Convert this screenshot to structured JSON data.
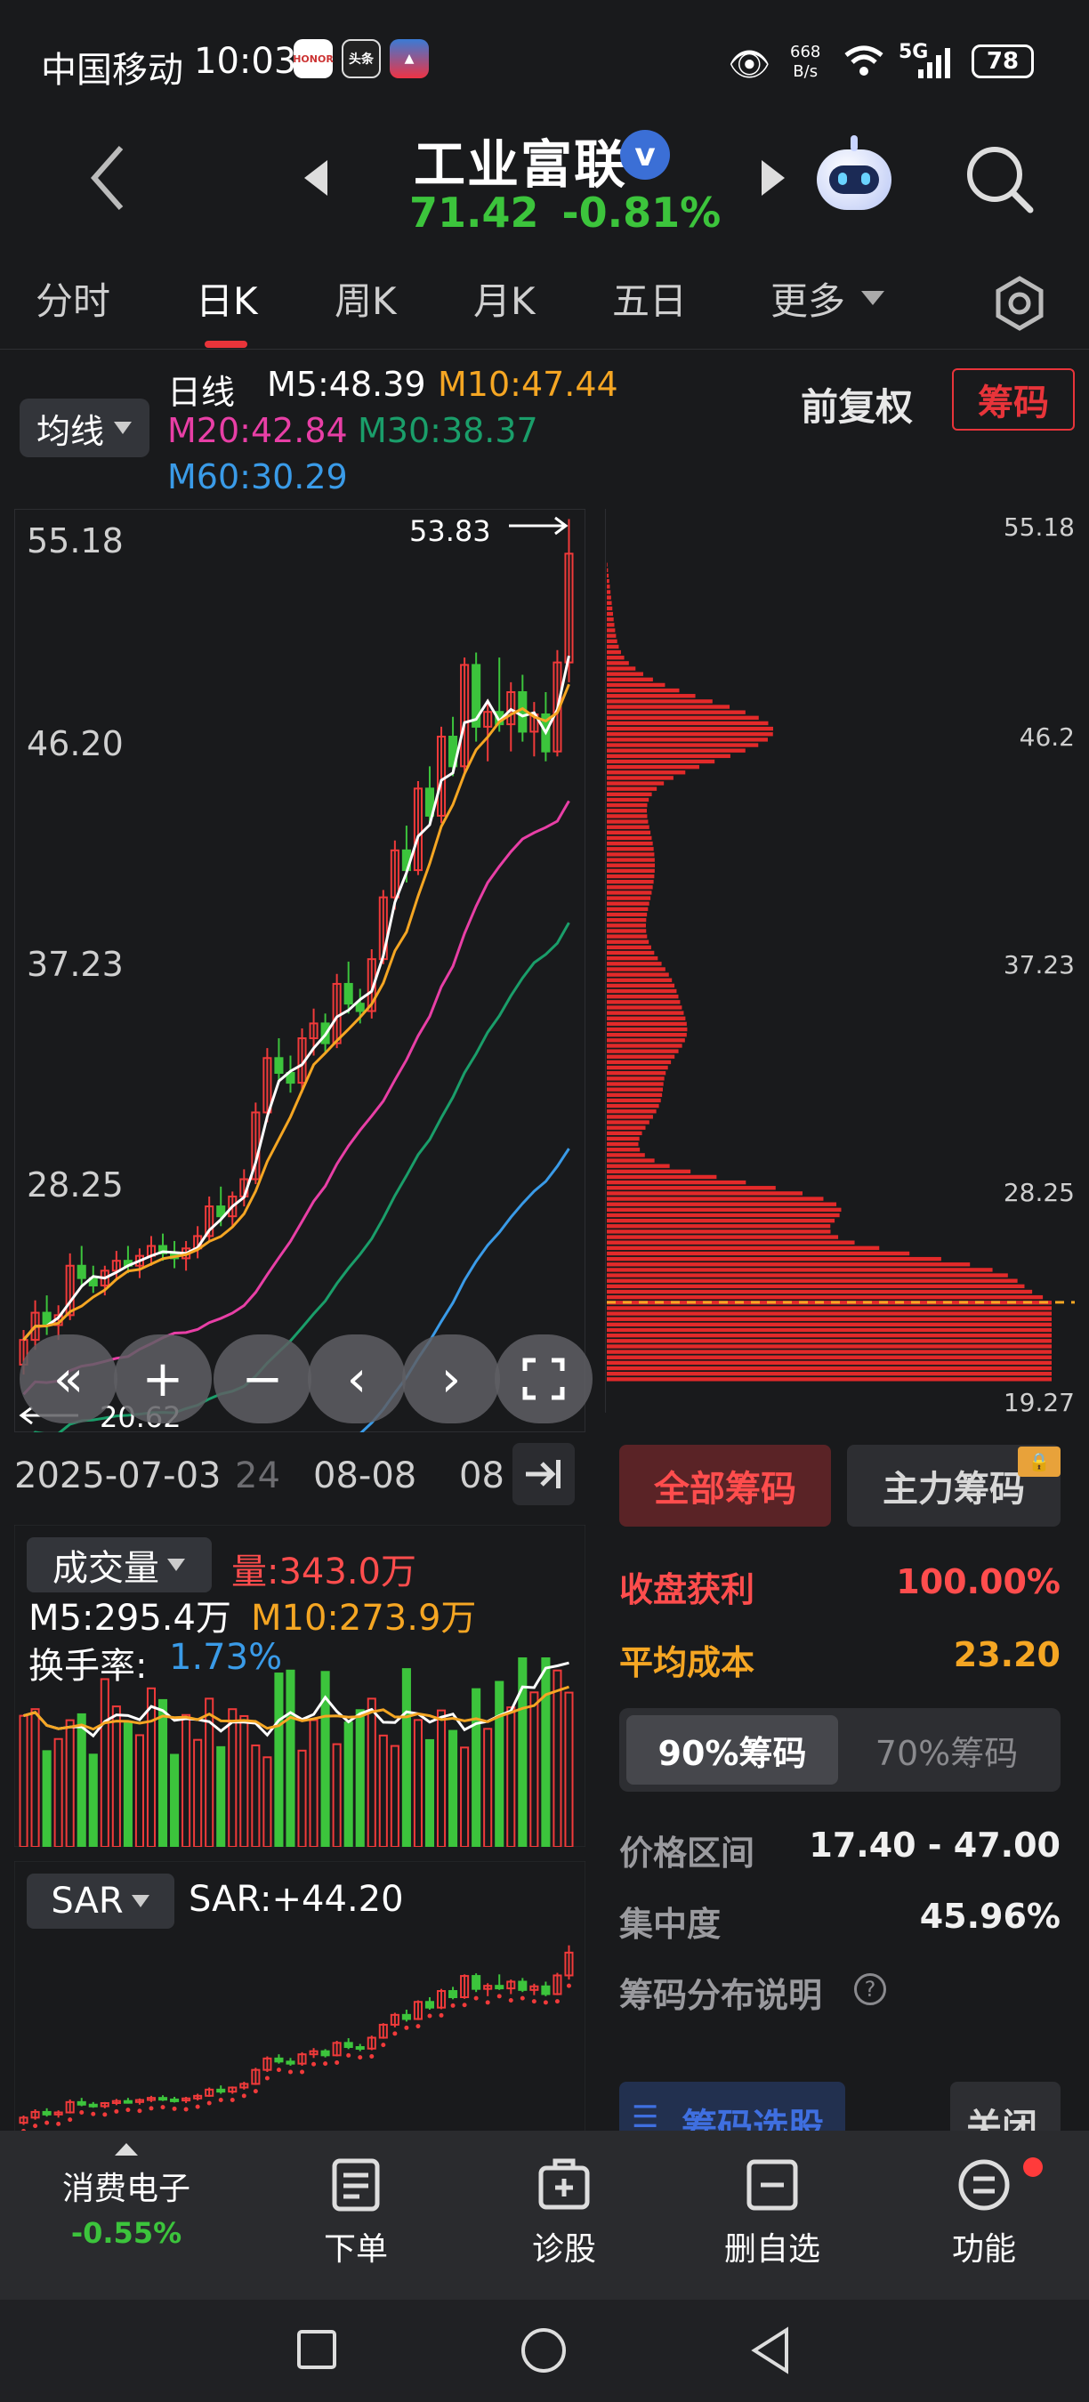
{
  "status_bar": {
    "carrier": "中国移动",
    "time": "10:03",
    "net_speed_top": "668",
    "net_speed_bottom": "B/s",
    "network": "5G",
    "battery": "78"
  },
  "header": {
    "stock_name": "工业富联",
    "price": "71.42",
    "change": "-0.81%"
  },
  "tabs": [
    "分时",
    "日K",
    "周K",
    "月K",
    "五日",
    "更多"
  ],
  "ma_bar": {
    "selector": "均线",
    "period": "日线",
    "m5": "M5:48.39",
    "m10": "M10:47.44",
    "m20": "M20:42.84",
    "m30": "M30:38.37",
    "m60": "M60:30.29",
    "fq_label": "前复权",
    "chouma_label": "筹码"
  },
  "colors": {
    "up": "#f03a3a",
    "down": "#3cc43c",
    "m5": "#ffffff",
    "m10": "#f5a623",
    "m20": "#e83fa6",
    "m30": "#1a9e6a",
    "m60": "#3a9be8",
    "bg": "#191a1c"
  },
  "kline": {
    "y_labels": [
      "55.18",
      "46.20",
      "37.23",
      "28.25"
    ],
    "high_label": "53.83",
    "low_label": "20.62",
    "x_dates": [
      "2025-07-03",
      "24",
      "08-08",
      "08"
    ]
  },
  "chip": {
    "y_labels": [
      "55.18",
      "46.2",
      "37.23",
      "28.25",
      "19.27"
    ],
    "tab_all": "全部筹码",
    "tab_main": "主力筹码",
    "profit_label": "收盘获利",
    "profit_value": "100.00%",
    "avgcost_label": "平均成本",
    "avgcost_value": "23.20",
    "seg_90": "90%筹码",
    "seg_70": "70%筹码",
    "range_label": "价格区间",
    "range_value": "17.40 - 47.00",
    "conc_label": "集中度",
    "conc_value": "45.96%",
    "desc_label": "筹码分布说明",
    "select_label": "筹码选股",
    "close_label": "关闭"
  },
  "volume": {
    "selector": "成交量",
    "vol": "量:343.0万",
    "m5": "M5:295.4万",
    "m10": "M10:273.9万",
    "turnover_label": "换手率:",
    "turnover_value": "1.73%"
  },
  "sar": {
    "selector": "SAR",
    "value": "SAR:+44.20"
  },
  "bottom_nav": {
    "sector": "消费电子",
    "sector_change": "-0.55%",
    "order": "下单",
    "diagnose": "诊股",
    "delete": "删自选",
    "function": "功能"
  },
  "chart_data": {
    "type": "candlestick",
    "ylim": [
      19.27,
      55.18
    ],
    "title": "",
    "candles": [
      [
        21.0,
        22.4,
        20.6,
        22.0
      ],
      [
        22.0,
        23.6,
        21.6,
        23.1
      ],
      [
        23.1,
        23.8,
        22.2,
        22.6
      ],
      [
        22.6,
        23.4,
        22.0,
        23.0
      ],
      [
        23.0,
        25.5,
        22.8,
        25.0
      ],
      [
        25.0,
        25.8,
        24.2,
        24.5
      ],
      [
        24.5,
        25.0,
        23.9,
        24.2
      ],
      [
        24.2,
        25.0,
        23.8,
        24.8
      ],
      [
        24.8,
        25.6,
        24.4,
        25.2
      ],
      [
        25.2,
        25.8,
        24.7,
        25.0
      ],
      [
        25.0,
        25.7,
        24.5,
        25.4
      ],
      [
        25.4,
        26.2,
        25.0,
        25.8
      ],
      [
        25.8,
        26.3,
        25.2,
        25.5
      ],
      [
        25.5,
        26.0,
        24.9,
        25.3
      ],
      [
        25.3,
        26.0,
        24.8,
        25.7
      ],
      [
        25.7,
        26.6,
        25.3,
        26.2
      ],
      [
        26.2,
        27.8,
        26.0,
        27.4
      ],
      [
        27.4,
        28.2,
        26.6,
        27.0
      ],
      [
        27.0,
        28.0,
        26.6,
        27.8
      ],
      [
        27.8,
        28.9,
        27.4,
        28.5
      ],
      [
        28.5,
        31.6,
        28.3,
        31.2
      ],
      [
        31.2,
        33.8,
        30.8,
        33.4
      ],
      [
        33.4,
        34.2,
        32.4,
        32.8
      ],
      [
        32.8,
        33.5,
        32.0,
        32.4
      ],
      [
        32.4,
        34.6,
        32.0,
        34.2
      ],
      [
        34.2,
        35.4,
        33.5,
        34.8
      ],
      [
        34.8,
        35.2,
        33.6,
        34.0
      ],
      [
        34.0,
        36.8,
        33.8,
        36.4
      ],
      [
        36.4,
        37.3,
        35.2,
        35.6
      ],
      [
        35.6,
        36.2,
        34.8,
        35.3
      ],
      [
        35.3,
        37.8,
        35.0,
        37.4
      ],
      [
        37.4,
        40.2,
        37.2,
        39.9
      ],
      [
        39.9,
        42.2,
        39.4,
        41.8
      ],
      [
        41.8,
        42.8,
        40.5,
        41.0
      ],
      [
        41.0,
        44.6,
        40.8,
        44.3
      ],
      [
        44.3,
        45.2,
        42.8,
        43.2
      ],
      [
        43.2,
        46.8,
        42.9,
        46.4
      ],
      [
        46.4,
        47.2,
        44.8,
        45.2
      ],
      [
        45.2,
        49.6,
        44.9,
        49.3
      ],
      [
        49.3,
        49.8,
        46.2,
        46.8
      ],
      [
        46.8,
        47.9,
        45.4,
        47.4
      ],
      [
        47.4,
        49.6,
        46.6,
        46.9
      ],
      [
        46.9,
        48.6,
        45.8,
        48.2
      ],
      [
        48.2,
        48.9,
        46.2,
        46.6
      ],
      [
        46.6,
        47.8,
        45.6,
        47.3
      ],
      [
        47.3,
        48.2,
        45.4,
        45.8
      ],
      [
        45.8,
        49.9,
        45.6,
        49.4
      ],
      [
        49.4,
        55.2,
        48.6,
        53.8
      ]
    ]
  }
}
